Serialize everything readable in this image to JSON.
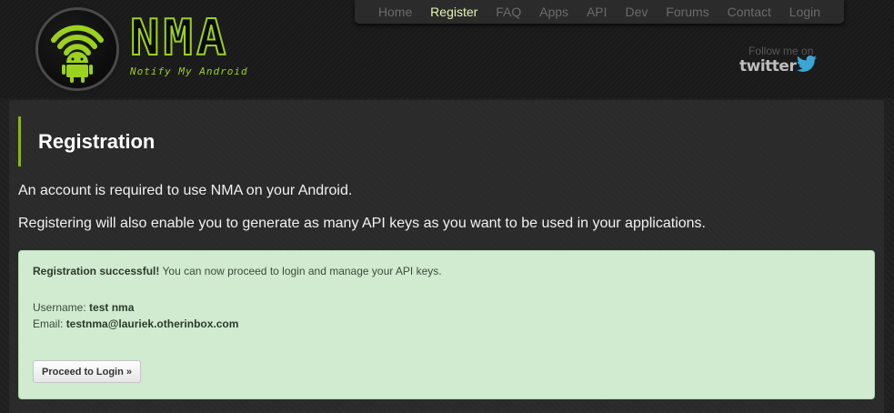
{
  "brand": {
    "name": "NMA",
    "tagline": "Notify My Android"
  },
  "nav": {
    "items": [
      {
        "label": "Home"
      },
      {
        "label": "Register",
        "active": true
      },
      {
        "label": "FAQ"
      },
      {
        "label": "Apps"
      },
      {
        "label": "API"
      },
      {
        "label": "Dev"
      },
      {
        "label": "Forums"
      },
      {
        "label": "Contact"
      },
      {
        "label": "Login"
      }
    ]
  },
  "social": {
    "follow_text": "Follow me on",
    "twitter_label": "twitter"
  },
  "page": {
    "title": "Registration",
    "intro1": "An account is required to use NMA on your Android.",
    "intro2": "Registering will also enable you to generate as many API keys as you want to be used in your applications."
  },
  "alert": {
    "heading": "Registration successful!",
    "message": "You can now proceed to login and manage your API keys.",
    "username_label": "Username:",
    "username_value": "test nma",
    "email_label": "Email:",
    "email_value": "testnma@lauriek.otherinbox.com",
    "button_label": "Proceed to Login »"
  },
  "colors": {
    "accent": "#9bd21e",
    "alert_bg": "#d0ebd0",
    "nav_active": "#e4f5b5"
  }
}
